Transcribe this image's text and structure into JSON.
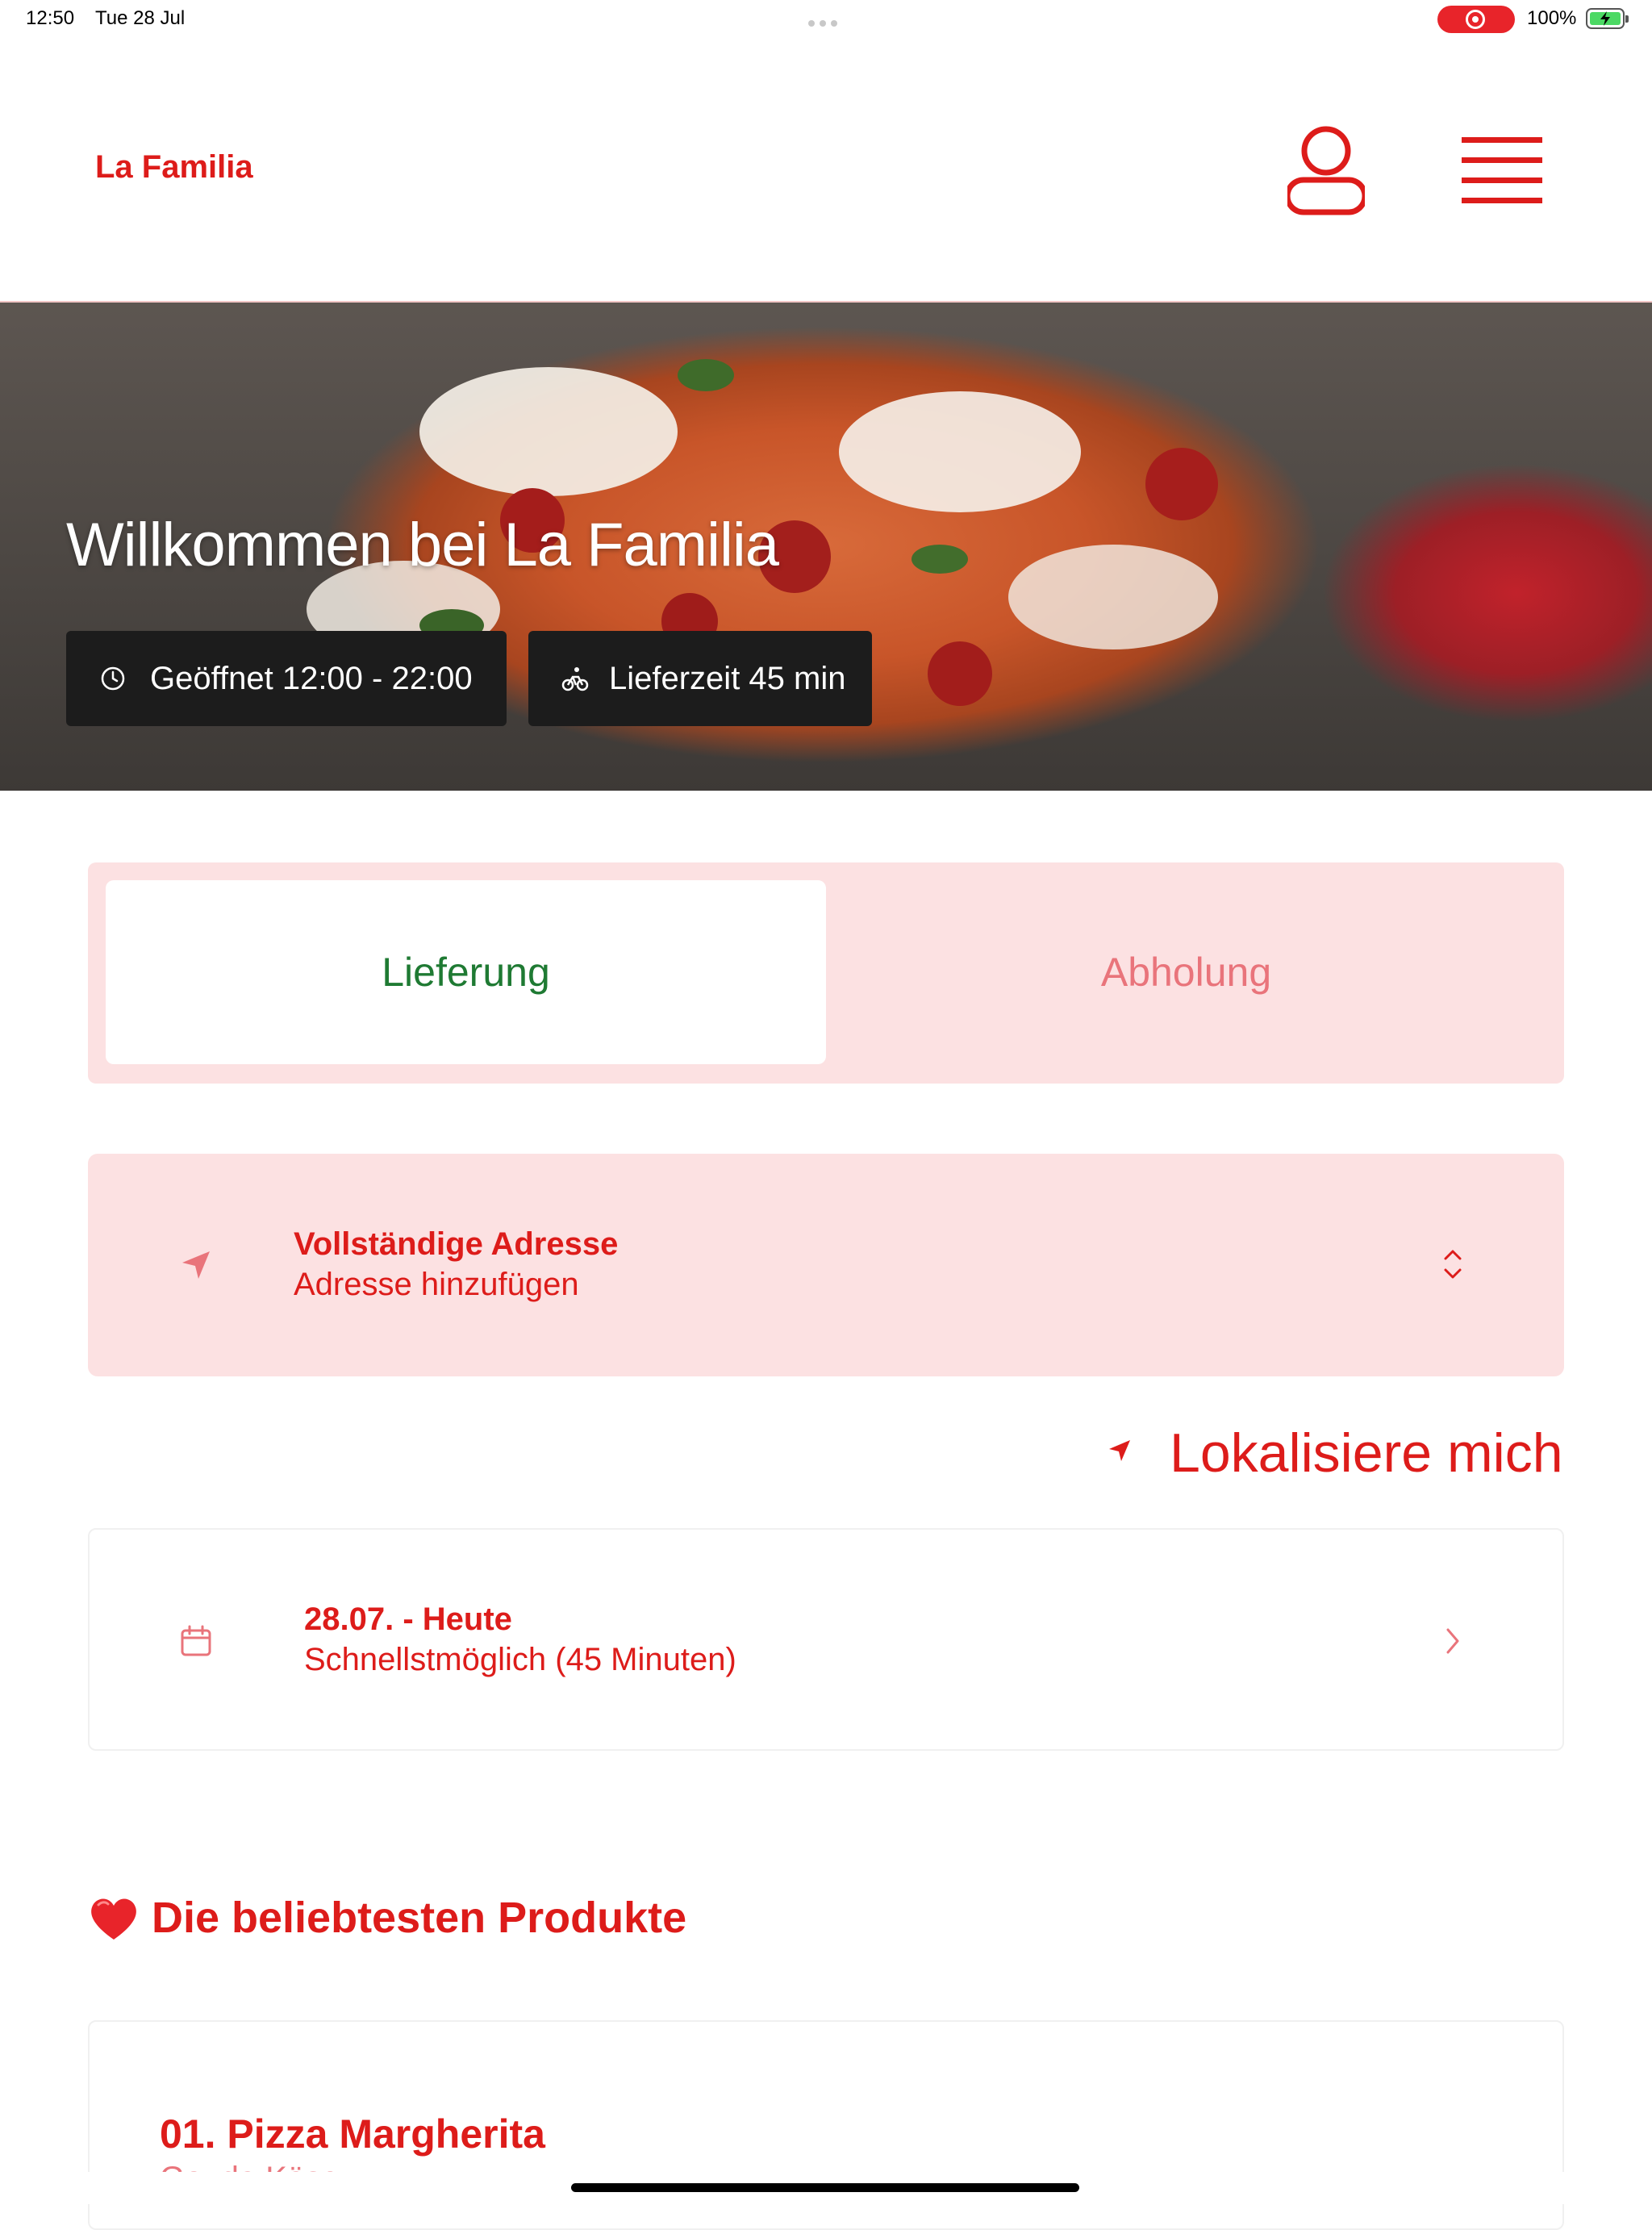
{
  "status_bar": {
    "time": "12:50",
    "date": "Tue 28 Jul",
    "battery": "100%"
  },
  "header": {
    "brand": "La Familia",
    "icons": [
      "user-icon",
      "hamburger-menu-icon"
    ]
  },
  "hero": {
    "title": "Willkommen bei La Familia",
    "hours_label": "Geöffnet 12:00 - 22:00",
    "delivery_time_label": "Lieferzeit 45 min",
    "icons": [
      "clock-icon",
      "bicycle-icon"
    ]
  },
  "order_mode": {
    "options": [
      "Lieferung",
      "Abholung"
    ],
    "selected": "Lieferung"
  },
  "address": {
    "title": "Vollständige Adresse",
    "subtitle": "Adresse hinzufügen",
    "icons": [
      "location-arrow-icon",
      "expand-chevrons-icon"
    ]
  },
  "locate": {
    "label": "Lokalisiere mich",
    "icon": "location-arrow-icon"
  },
  "delivery_date": {
    "title": "28.07. - Heute",
    "subtitle": "Schnellstmöglich (45 Minuten)",
    "icons": [
      "calendar-icon",
      "chevron-right-icon"
    ]
  },
  "popular": {
    "title": "Die beliebtesten Produkte",
    "icon": "heart-icon",
    "products": [
      {
        "name": "01. Pizza Margherita",
        "subtitle": "Gouda Käse"
      }
    ]
  },
  "colors": {
    "brand_red": "#dd1c1a",
    "selected_green": "#1f7a33",
    "pink_bg": "#fce1e2",
    "muted_red": "#e9747b"
  }
}
